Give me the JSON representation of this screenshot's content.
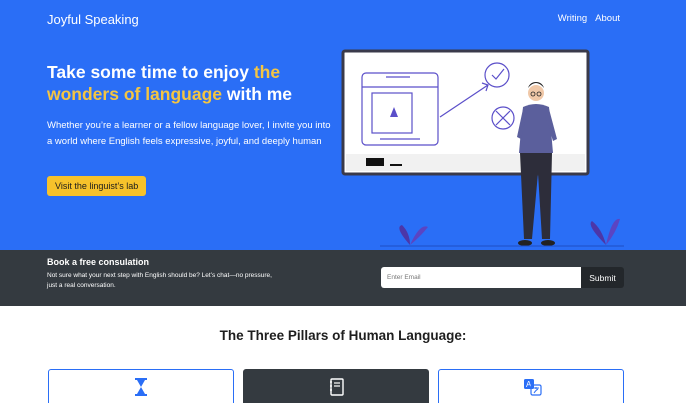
{
  "header": {
    "brand": "Joyful Speaking",
    "nav": [
      "Writing",
      "About"
    ]
  },
  "hero": {
    "headline_part1": "Take some time to enjoy ",
    "headline_highlight": "the wonders of language",
    "headline_part2": " with me",
    "lead": "Whether you’re a learner or a fellow language lover, I invite you into a world where English feels expressive, joyful, and deeply human",
    "cta_label": "Visit the linguist’s lab"
  },
  "consultation": {
    "title": "Book a free consulation",
    "text": "Not sure what your next step with English should be? Let’s chat—no pressure, just a real conversation.",
    "email_placeholder": "Enter Email",
    "submit_label": "Submit"
  },
  "pillars": {
    "title": "The Three Pillars of Human Language:",
    "cards": [
      {
        "icon": "hourglass-icon"
      },
      {
        "icon": "book-icon"
      },
      {
        "icon": "translate-icon"
      }
    ]
  },
  "colors": {
    "hero_bg": "#2a6ef6",
    "accent_yellow": "#f4c542",
    "button_yellow": "#f7c22b",
    "dark_band": "#343a40"
  }
}
